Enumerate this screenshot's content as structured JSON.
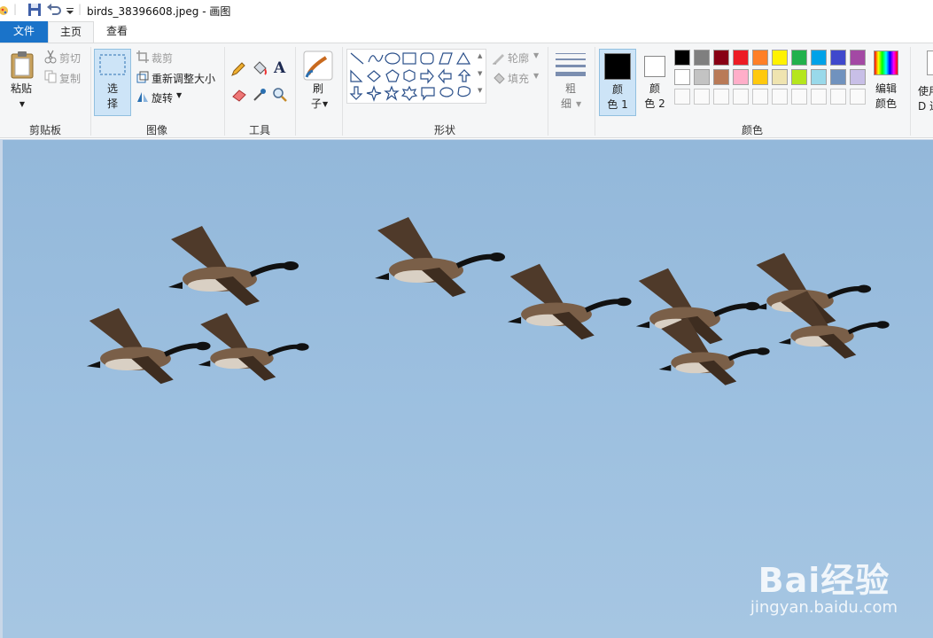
{
  "titlebar": {
    "title": "birds_38396608.jpeg - 画图"
  },
  "tabs": {
    "file": "文件",
    "home": "主页",
    "view": "查看"
  },
  "clipboard": {
    "paste": "粘贴",
    "cut": "剪切",
    "copy": "复制",
    "group": "剪贴板"
  },
  "image_group": {
    "select_line1": "选",
    "select_line2": "择",
    "crop": "裁剪",
    "resize": "重新调整大小",
    "rotate": "旋转",
    "group": "图像"
  },
  "tools": {
    "group": "工具",
    "text_glyph": "A"
  },
  "brushes": {
    "line1": "刷",
    "line2": "子"
  },
  "shapes": {
    "outline": "轮廓",
    "fill": "填充",
    "group": "形状"
  },
  "size": {
    "line1": "粗",
    "line2": "细"
  },
  "colors": {
    "color1_line1": "颜",
    "color1_line2": "色 1",
    "color2_line1": "颜",
    "color2_line2": "色 2",
    "edit_line1": "编辑",
    "edit_line2": "颜色",
    "paint3d_line1": "使用",
    "paint3d_line2": "D 进",
    "group": "颜色",
    "color1": "#000000",
    "color2": "#ffffff",
    "palette_row1": [
      "#000000",
      "#7f7f7f",
      "#880015",
      "#ed1c24",
      "#ff7f27",
      "#fff200",
      "#22b14c",
      "#00a2e8",
      "#3f48cc",
      "#a349a4"
    ],
    "palette_row2": [
      "#ffffff",
      "#c3c3c3",
      "#b97a57",
      "#ffaec9",
      "#ffc90e",
      "#efe4b0",
      "#b5e61d",
      "#99d9ea",
      "#7092be",
      "#c8bfe7"
    ]
  },
  "watermark": {
    "logo": "Bai经验",
    "url": "jingyan.baidu.com"
  }
}
